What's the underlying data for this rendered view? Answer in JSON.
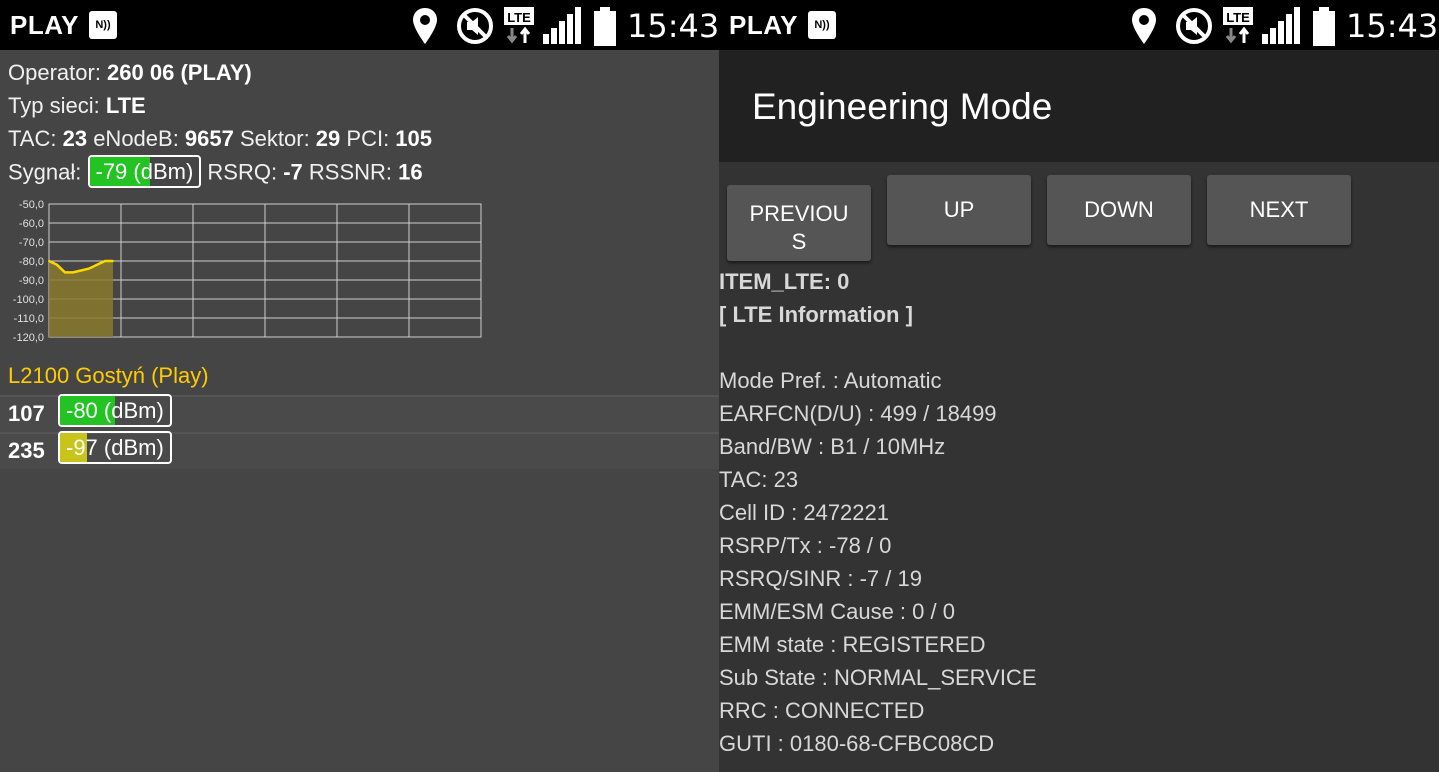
{
  "status_bar": {
    "carrier": "PLAY",
    "nfc_label": "N))",
    "time": "15:43",
    "network_type": "LTE",
    "icons": [
      "location-icon",
      "mute-icon",
      "lte-data-icon",
      "signal-icon",
      "battery-icon"
    ]
  },
  "left": {
    "operator_label": "Operator: ",
    "operator_value": "260 06 (PLAY)",
    "network_label": "Typ sieci: ",
    "network_value": "LTE",
    "tac_label": "TAC: ",
    "tac_value": "23",
    "enodeb_label": " eNodeB: ",
    "enodeb_value": "9657",
    "sector_label": " Sektor: ",
    "sector_value": "29",
    "pci_label": " PCI: ",
    "pci_value": "105",
    "signal_label": "Sygnał: ",
    "signal_value": "-79 (dBm)",
    "signal_level": 0.55,
    "rsrq_label": " RSRQ: ",
    "rsrq_value": "-7",
    "rssnr_label": " RSSNR: ",
    "rssnr_value": "16",
    "cell_name": "L2100 Gostyń (Play)",
    "neighbors": [
      {
        "pci": "107",
        "signal": "-80 (dBm)",
        "level": 0.5,
        "color": "#22c322"
      },
      {
        "pci": "235",
        "signal": "-97 (dBm)",
        "level": 0.25,
        "color": "#c8c41a"
      }
    ],
    "colors": {
      "good": "#22c322",
      "medium": "#c8c41a",
      "chart_line": "#ffd700",
      "cell_name": "#ffcc00"
    }
  },
  "chart_data": {
    "type": "area",
    "y_ticks": [
      "-50,0",
      "-60,0",
      "-70,0",
      "-80,0",
      "-90,0",
      "-100,0",
      "-110,0",
      "-120,0"
    ],
    "ylim": [
      -120,
      -50
    ],
    "x": [
      0,
      1,
      2,
      3,
      4,
      5,
      6,
      7,
      8
    ],
    "values": [
      -80,
      -82,
      -86,
      -86,
      -85,
      -84,
      -82,
      -80,
      -80
    ],
    "grid": true
  },
  "right": {
    "title": "Engineering Mode",
    "buttons": {
      "previous": "PREVIOUS",
      "up": "UP",
      "down": "DOWN",
      "next": "NEXT"
    },
    "item_header": "ITEM_LTE: 0",
    "section_header": "[ LTE Information ]",
    "rows": [
      "Mode Pref. : Automatic",
      "EARFCN(D/U) :  499 / 18499",
      "Band/BW :  B1 / 10MHz",
      "TAC:  23",
      "Cell ID :  2472221",
      "RSRP/Tx :  -78 / 0",
      "RSRQ/SINR :  -7 / 19",
      "EMM/ESM Cause :  0 / 0",
      "EMM state :  REGISTERED",
      "Sub State :  NORMAL_SERVICE",
      "RRC :  CONNECTED",
      "GUTI :  0180-68-CFBC08CD"
    ]
  }
}
